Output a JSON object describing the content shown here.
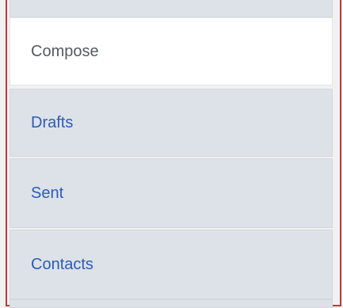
{
  "nav": {
    "items": [
      {
        "label": "Compose",
        "active": true
      },
      {
        "label": "Drafts",
        "active": false
      },
      {
        "label": "Sent",
        "active": false
      },
      {
        "label": "Contacts",
        "active": false
      }
    ]
  },
  "colors": {
    "active_bg": "#ffffff",
    "inactive_bg": "#dde2e8",
    "link_text": "#2e5bb5",
    "active_text": "#555a60",
    "frame_border": "#c0393b"
  }
}
